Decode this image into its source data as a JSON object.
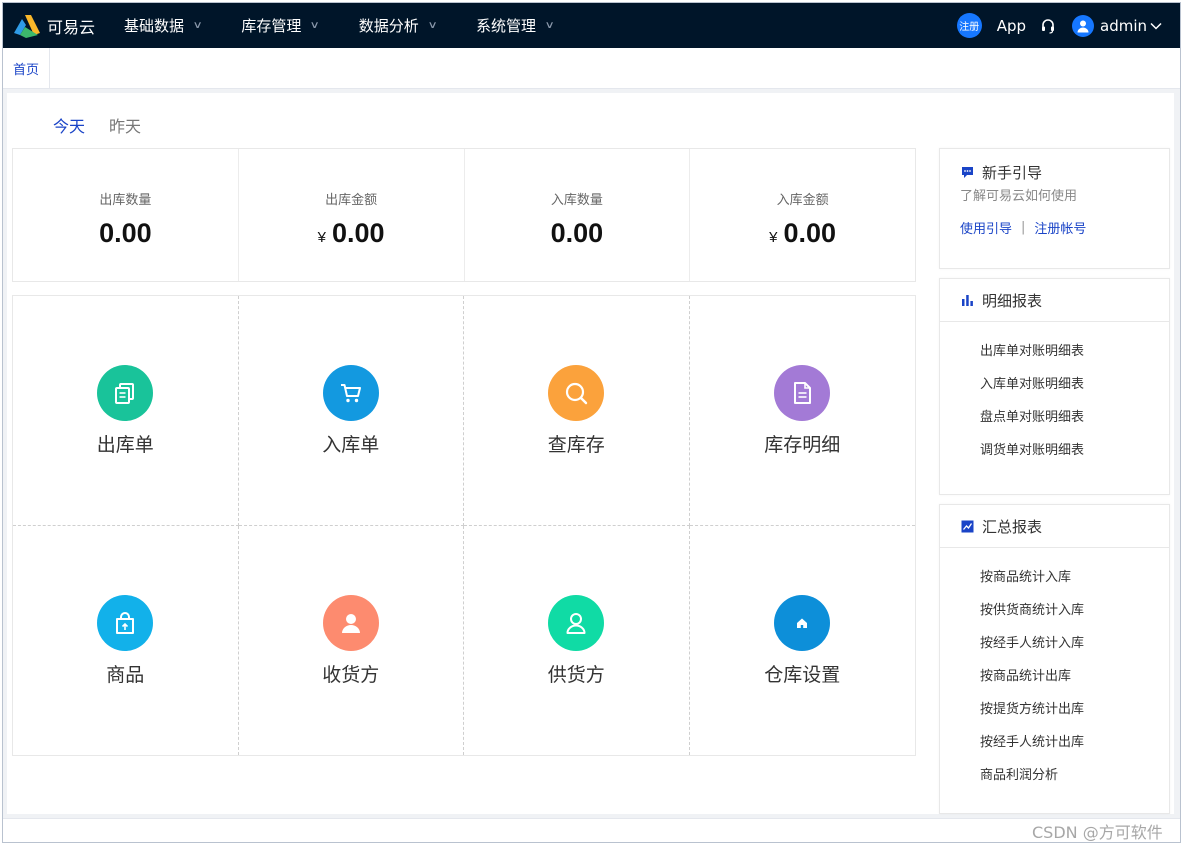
{
  "app": {
    "name": "可易云"
  },
  "nav": {
    "menus": [
      {
        "label": "基础数据"
      },
      {
        "label": "库存管理"
      },
      {
        "label": "数据分析"
      },
      {
        "label": "系统管理"
      }
    ],
    "register_badge": "注册",
    "app_link": "App",
    "username": "admin"
  },
  "tabs": {
    "home": "首页"
  },
  "day_tabs": {
    "today": "今天",
    "yesterday": "昨天",
    "active": "今天"
  },
  "stats": [
    {
      "label": "出库数量",
      "currency": "",
      "value": "0.00"
    },
    {
      "label": "出库金额",
      "currency": "¥",
      "value": "0.00"
    },
    {
      "label": "入库数量",
      "currency": "",
      "value": "0.00"
    },
    {
      "label": "入库金额",
      "currency": "¥",
      "value": "0.00"
    }
  ],
  "shortcuts": [
    {
      "label": "出库单",
      "icon": "copy-icon",
      "color": "#19c39a"
    },
    {
      "label": "入库单",
      "icon": "cart-icon",
      "color": "#1399e0"
    },
    {
      "label": "查库存",
      "icon": "search-icon",
      "color": "#fba23c"
    },
    {
      "label": "库存明细",
      "icon": "document-icon",
      "color": "#a37ad6"
    },
    {
      "label": "商品",
      "icon": "shopping-bag-icon",
      "color": "#12b1ea"
    },
    {
      "label": "收货方",
      "icon": "person-icon",
      "color": "#fd8b6f"
    },
    {
      "label": "供货方",
      "icon": "person-outline-icon",
      "color": "#10dba5"
    },
    {
      "label": "仓库设置",
      "icon": "home-icon",
      "color": "#0d8fd9"
    }
  ],
  "guide": {
    "title": "新手引导",
    "subtitle": "了解可易云如何使用",
    "link1": "使用引导",
    "separator": "|",
    "link2": "注册帐号"
  },
  "detail_reports": {
    "title": "明细报表",
    "items": [
      "出库单对账明细表",
      "入库单对账明细表",
      "盘点单对账明细表",
      "调货单对账明细表"
    ]
  },
  "summary_reports": {
    "title": "汇总报表",
    "items": [
      "按商品统计入库",
      "按供货商统计入库",
      "按经手人统计入库",
      "按商品统计出库",
      "按提货方统计出库",
      "按经手人统计出库",
      "商品利润分析"
    ]
  },
  "watermark": "CSDN @方可软件",
  "colors": {
    "nav_bg": "#001529",
    "accent": "#1a44c7",
    "badge": "#1677ff"
  }
}
